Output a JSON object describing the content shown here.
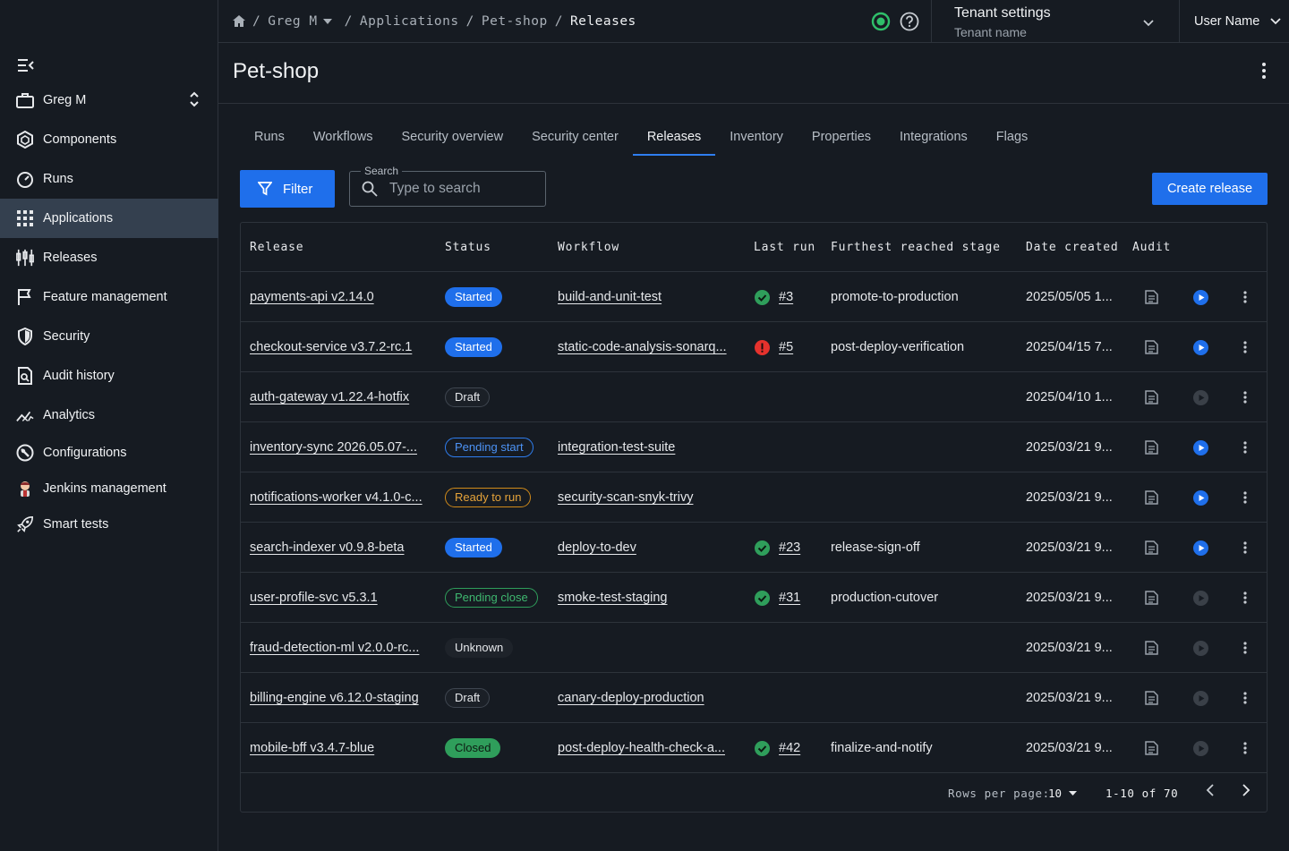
{
  "sidebar": {
    "items": [
      {
        "label": "Greg M",
        "icon": "briefcase-icon"
      },
      {
        "label": "Components",
        "icon": "cube-icon"
      },
      {
        "label": "Runs",
        "icon": "gauge-icon"
      },
      {
        "label": "Applications",
        "icon": "grid-icon"
      },
      {
        "label": "Releases",
        "icon": "releases-icon"
      },
      {
        "label": "Feature management",
        "icon": "flag-icon"
      },
      {
        "label": "Security",
        "icon": "shield-icon"
      },
      {
        "label": "Audit history",
        "icon": "audit-doc-icon"
      },
      {
        "label": "Analytics",
        "icon": "analytics-icon"
      },
      {
        "label": "Configurations",
        "icon": "config-icon"
      },
      {
        "label": "Jenkins management",
        "icon": "jenkins-icon"
      },
      {
        "label": "Smart tests",
        "icon": "rocket-icon"
      }
    ]
  },
  "header": {
    "breadcrumb": {
      "org": "Greg M",
      "section": "Applications",
      "app": "Pet-shop",
      "current": "Releases"
    },
    "tenant_title": "Tenant settings",
    "tenant_subtitle": "Tenant name",
    "user_name": "User Name"
  },
  "page": {
    "title": "Pet-shop"
  },
  "tabs": [
    "Runs",
    "Workflows",
    "Security overview",
    "Security center",
    "Releases",
    "Inventory",
    "Properties",
    "Integrations",
    "Flags"
  ],
  "toolbar": {
    "filter_label": "Filter",
    "search_legend": "Search",
    "search_placeholder": "Type to search",
    "create_label": "Create release"
  },
  "table": {
    "headers": [
      "Release",
      "Status",
      "Workflow",
      "Last run",
      "Furthest reached stage",
      "Date created",
      "Audit"
    ],
    "rows": [
      {
        "release": "payments-api v2.14.0",
        "status": "Started",
        "status_type": "started",
        "workflow": "build-and-unit-test",
        "run_state": "success",
        "run": "#3",
        "stage": "promote-to-production",
        "date": "2025/05/05 1...",
        "play_active": true
      },
      {
        "release": "checkout-service v3.7.2-rc.1",
        "status": "Started",
        "status_type": "started",
        "workflow": "static-code-analysis-sonarq...",
        "run_state": "error",
        "run": "#5",
        "stage": "post-deploy-verification",
        "date": "2025/04/15 7...",
        "play_active": true
      },
      {
        "release": "auth-gateway v1.22.4-hotfix",
        "status": "Draft",
        "status_type": "draft",
        "workflow": "",
        "run_state": "",
        "run": "",
        "stage": "",
        "date": "2025/04/10 1...",
        "play_active": false
      },
      {
        "release": "inventory-sync 2026.05.07-...",
        "status": "Pending start",
        "status_type": "pending-start",
        "workflow": "integration-test-suite",
        "run_state": "",
        "run": "",
        "stage": "",
        "date": "2025/03/21 9...",
        "play_active": true
      },
      {
        "release": "notifications-worker v4.1.0-c...",
        "status": "Ready to run",
        "status_type": "ready",
        "workflow": "security-scan-snyk-trivy",
        "run_state": "",
        "run": "",
        "stage": "",
        "date": "2025/03/21 9...",
        "play_active": true
      },
      {
        "release": "search-indexer v0.9.8-beta",
        "status": "Started",
        "status_type": "started",
        "workflow": "deploy-to-dev",
        "run_state": "success",
        "run": "#23",
        "stage": "release-sign-off",
        "date": "2025/03/21 9...",
        "play_active": true
      },
      {
        "release": "user-profile-svc v5.3.1",
        "status": "Pending close",
        "status_type": "pending-close",
        "workflow": "smoke-test-staging",
        "run_state": "success",
        "run": "#31",
        "stage": "production-cutover",
        "date": "2025/03/21 9...",
        "play_active": false
      },
      {
        "release": "fraud-detection-ml v2.0.0-rc...",
        "status": "Unknown",
        "status_type": "unknown",
        "workflow": "",
        "run_state": "",
        "run": "",
        "stage": "",
        "date": "2025/03/21 9...",
        "play_active": false
      },
      {
        "release": "billing-engine v6.12.0-staging",
        "status": "Draft",
        "status_type": "draft",
        "workflow": "canary-deploy-production",
        "run_state": "",
        "run": "",
        "stage": "",
        "date": "2025/03/21 9...",
        "play_active": false
      },
      {
        "release": "mobile-bff v3.4.7-blue",
        "status": "Closed",
        "status_type": "closed",
        "workflow": "post-deploy-health-check-a...",
        "run_state": "success",
        "run": "#42",
        "stage": "finalize-and-notify",
        "date": "2025/03/21 9...",
        "play_active": false
      }
    ]
  },
  "pagination": {
    "rows_label": "Rows per page:",
    "rows_value": "10",
    "range": "1-10 of 70"
  },
  "colors": {
    "accent": "#1f6feb",
    "success": "#2f9e5b",
    "error": "#e5322d",
    "warning": "#d08a1a",
    "health": "#2fbf6a"
  }
}
